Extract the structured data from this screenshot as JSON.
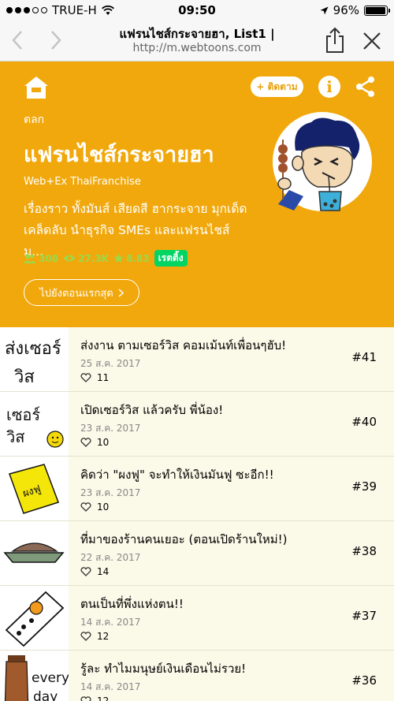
{
  "status": {
    "carrier": "TRUE-H",
    "time": "09:50",
    "battery": "96%",
    "battery_level": 0.96
  },
  "browser": {
    "title": "แฟรนไชส์กระจายฮา, List1 |",
    "url": "http://m.webtoons.com"
  },
  "hero": {
    "subscribe_label": "+ ติดตาม",
    "info_label": "i",
    "genre": "ตลก",
    "title": "แฟรนไชส์กระจายฮา",
    "author": "Web+Ex ThaiFranchise",
    "description": "เรื่องราว ทั้งมันส์ เสียดสี ฮากระจาย มุกเด็ด เคล็ดลับ นำธุรกิจ SMEs และแฟรนไชส์ ม...",
    "subscribers": "308",
    "views": "27.3K",
    "rating": "8.83",
    "rating_badge": "เรตติ้ง",
    "first_episode_label": "ไปยังตอนแรกสุด",
    "colors": {
      "background": "#f1a80c",
      "badge": "#00d564",
      "stats": "#9bd84a"
    }
  },
  "episodes": [
    {
      "thumb_text": [
        "ส่งเซอร์",
        "วิส"
      ],
      "title": "ส่งงาน ตามเซอร์วิส คอมเม้นท์เพื่อนๆฮับ!",
      "date": "25 ส.ค. 2017",
      "likes": "11",
      "number": "#41"
    },
    {
      "thumb_text": [
        "เซอร์",
        "วิส"
      ],
      "title": "เปิดเซอร์วิส แล้วครับ พี่น้อง!",
      "date": "23 ส.ค. 2017",
      "likes": "10",
      "number": "#40"
    },
    {
      "thumb_text": [
        "ผงฟู"
      ],
      "title": "คิดว่า \"ผงฟู\" จะทำให้เงินมันฟู ซะอีก!!",
      "date": "23 ส.ค. 2017",
      "likes": "10",
      "number": "#39"
    },
    {
      "thumb_text": [],
      "title": "ที่มาของร้านคนเยอะ (ตอนเปิดร้านใหม่!)",
      "date": "22 ส.ค. 2017",
      "likes": "14",
      "number": "#38"
    },
    {
      "thumb_text": [],
      "title": "ตนเป็นที่พึ่งแห่งตน!!",
      "date": "14 ส.ค. 2017",
      "likes": "12",
      "number": "#37"
    },
    {
      "thumb_text": [
        "every",
        "day"
      ],
      "title": "รู้ละ ทำไมมนุษย์เงินเดือนไม่รวย!",
      "date": "14 ส.ค. 2017",
      "likes": "12",
      "number": "#36"
    }
  ]
}
